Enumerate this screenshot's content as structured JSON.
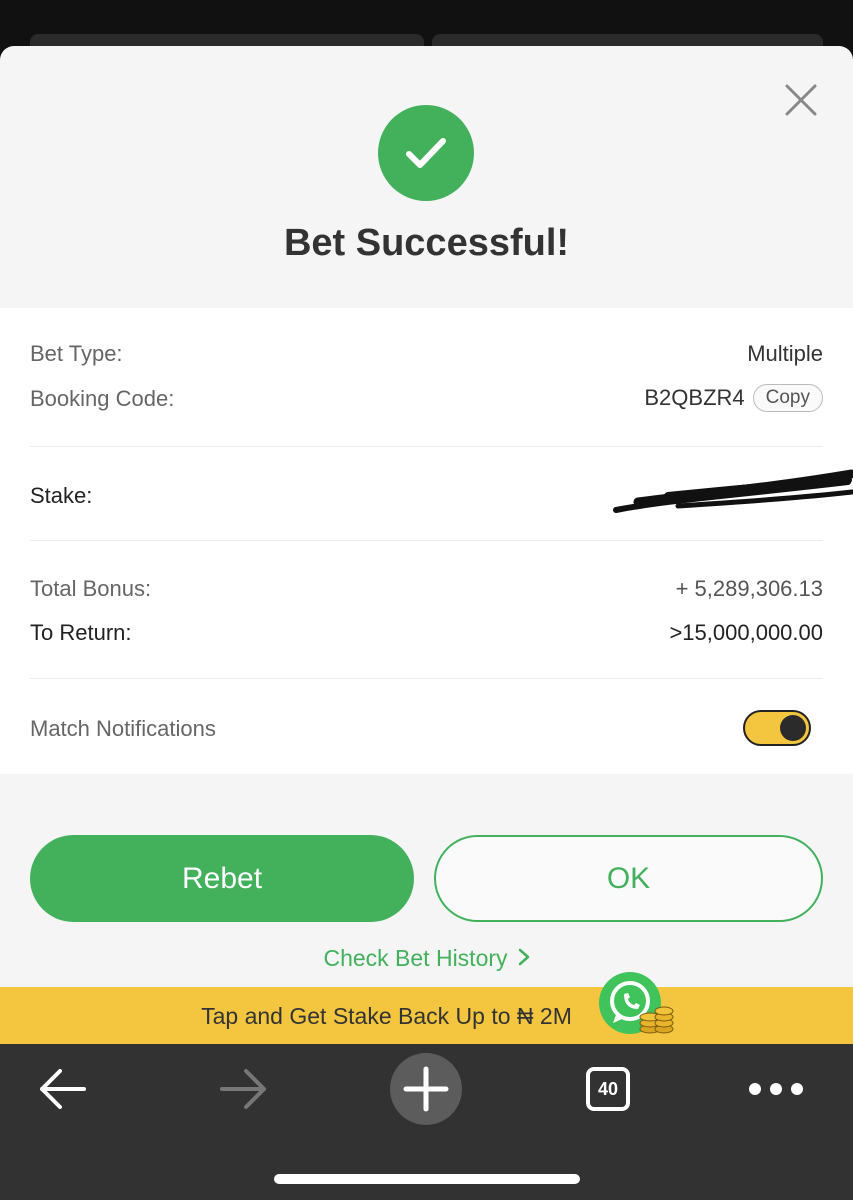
{
  "modal": {
    "title": "Bet Successful!",
    "bet_type_label": "Bet Type:",
    "bet_type_value": "Multiple",
    "booking_code_label": "Booking Code:",
    "booking_code_value": "B2QBZR4",
    "copy_label": "Copy",
    "stake_label": "Stake:",
    "total_bonus_label": "Total Bonus:",
    "total_bonus_value": "+ 5,289,306.13",
    "to_return_label": "To Return:",
    "to_return_value": ">15,000,000.00",
    "notifications_label": "Match Notifications",
    "notifications_on": true,
    "rebet_label": "Rebet",
    "ok_label": "OK",
    "history_link": "Check Bet History"
  },
  "promo": {
    "text": "Tap and Get Stake Back Up to ₦ 2M"
  },
  "browser_toolbar": {
    "tab_count": "40"
  },
  "colors": {
    "accent_green": "#43b05c",
    "promo_yellow": "#f4c63f",
    "toolbar_dark": "#323232"
  },
  "icons": [
    "close-icon",
    "checkmark-icon",
    "chevron-right-icon",
    "whatsapp-icon",
    "coins-icon",
    "back-arrow-icon",
    "forward-arrow-icon",
    "plus-icon",
    "tabs-icon",
    "more-icon"
  ]
}
